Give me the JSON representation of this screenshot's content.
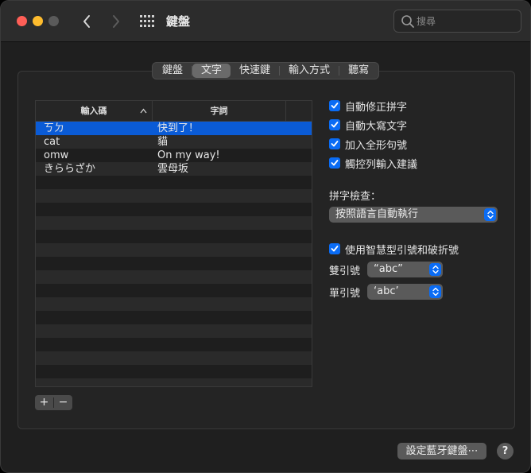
{
  "window": {
    "title": "鍵盤"
  },
  "search": {
    "placeholder": "搜尋"
  },
  "tabs": [
    {
      "label": "鍵盤",
      "active": false
    },
    {
      "label": "文字",
      "active": true
    },
    {
      "label": "快速鍵",
      "active": false
    },
    {
      "label": "輸入方式",
      "active": false
    },
    {
      "label": "聽寫",
      "active": false
    }
  ],
  "table": {
    "col1_header": "輸入碼",
    "col2_header": "字詞",
    "rows": [
      {
        "replace": "ㄎㄉ",
        "with": "快到了！",
        "selected": true
      },
      {
        "replace": "cat",
        "with": "貓",
        "selected": false
      },
      {
        "replace": "omw",
        "with": "On my way!",
        "selected": false
      },
      {
        "replace": "きららざか",
        "with": "雲母坂",
        "selected": false
      }
    ],
    "empty_row_count": 16
  },
  "controls": {
    "add_label": "+",
    "remove_label": "−"
  },
  "options": {
    "checkboxes": [
      {
        "label": "自動修正拼字",
        "checked": true
      },
      {
        "label": "自動大寫文字",
        "checked": true
      },
      {
        "label": "加入全形句號",
        "checked": true
      },
      {
        "label": "觸控列輸入建議",
        "checked": true
      }
    ],
    "spelling_label": "拼字檢查：",
    "spelling_value": "按照語言自動執行",
    "smart_quotes": {
      "label": "使用智慧型引號和破折號",
      "checked": true
    },
    "double_label": "雙引號",
    "double_value": "“abc”",
    "single_label": "單引號",
    "single_value": "‘abc’"
  },
  "footer": {
    "bluetooth_label": "設定藍牙鍵盤⋯",
    "help_label": "?"
  },
  "colors": {
    "accent": "#0a6cf5",
    "selection": "#0a5bd6"
  }
}
